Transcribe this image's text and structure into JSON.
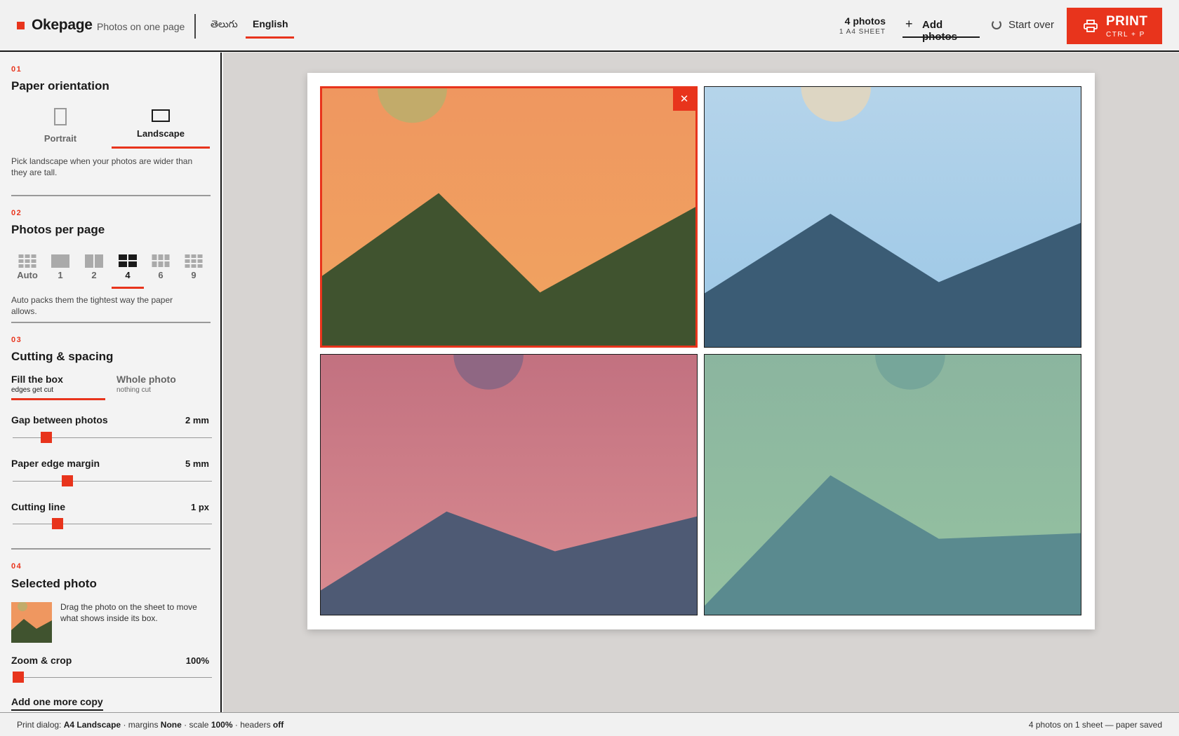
{
  "app": {
    "name": "Okepage",
    "tagline": "Photos on one page",
    "accent": "#e8341c"
  },
  "header": {
    "languages": [
      {
        "label": "తెలుగు",
        "active": false
      },
      {
        "label": "English",
        "active": true
      }
    ],
    "photo_count": "4 photos",
    "sheet_count": "1 A4 SHEET",
    "add_label": "Add photos",
    "add_icon": "plus-icon",
    "start_over_label": "Start over",
    "start_over_icon": "refresh-icon",
    "print_label": "PRINT",
    "print_shortcut": "CTRL + P",
    "print_icon": "printer-icon"
  },
  "sidebar": {
    "orientation": {
      "num": "01",
      "title": "Paper orientation",
      "options": [
        {
          "label": "Portrait",
          "icon": "portrait-page-icon",
          "active": false
        },
        {
          "label": "Landscape",
          "icon": "landscape-page-icon",
          "active": true
        }
      ],
      "hint": "Pick landscape when your photos are wider than they are tall."
    },
    "per_page": {
      "num": "02",
      "title": "Photos per page",
      "options": [
        {
          "label": "Auto",
          "active": false
        },
        {
          "label": "1",
          "active": false
        },
        {
          "label": "2",
          "active": false
        },
        {
          "label": "4",
          "active": true
        },
        {
          "label": "6",
          "active": false
        },
        {
          "label": "9",
          "active": false
        }
      ],
      "hint": "Auto packs them the tightest way the paper allows."
    },
    "cutting": {
      "num": "03",
      "title": "Cutting & spacing",
      "fill": {
        "label": "Fill the box",
        "sub": "edges get cut",
        "active": true
      },
      "whole": {
        "label": "Whole photo",
        "sub": "nothing cut",
        "active": false
      },
      "sliders": [
        {
          "label": "Gap between photos",
          "value": "2 mm",
          "level": 0.15
        },
        {
          "label": "Paper edge margin",
          "value": "5 mm",
          "level": 0.26
        },
        {
          "label": "Cutting line",
          "value": "1 px",
          "level": 0.21
        }
      ]
    },
    "selected": {
      "num": "04",
      "title": "Selected photo",
      "desc": "Drag the photo on the sheet to move what shows inside its box.",
      "zoom_label": "Zoom & crop",
      "zoom_value": "100%",
      "zoom_level": 0.0,
      "copy_label": "Add one more copy"
    }
  },
  "photos": [
    {
      "sky_top": "#ef9760",
      "sky_bottom": "#f0a460",
      "sun": "#c2ab6a",
      "mountain": "#40532f",
      "selected": true
    },
    {
      "sky_top": "#b5d4ea",
      "sky_bottom": "#9bc7e6",
      "sun": "#ddd6c3",
      "mountain": "#3b5c75",
      "selected": false
    },
    {
      "sky_top": "#c27180",
      "sky_bottom": "#da8c91",
      "sun": "#8f6783",
      "mountain": "#4e5a74",
      "selected": false
    },
    {
      "sky_top": "#8bb59f",
      "sky_bottom": "#95c2a1",
      "sun": "#76a69a",
      "mountain": "#5a8a8f",
      "selected": false
    }
  ],
  "status": {
    "prefix": "Print dialog:",
    "paper": "A4 Landscape",
    "margins_label": "· margins",
    "margins": "None",
    "scale_label": "· scale",
    "scale": "100%",
    "headers_label": "· headers",
    "headers": "off",
    "summary": "4 photos on 1 sheet — paper saved"
  }
}
